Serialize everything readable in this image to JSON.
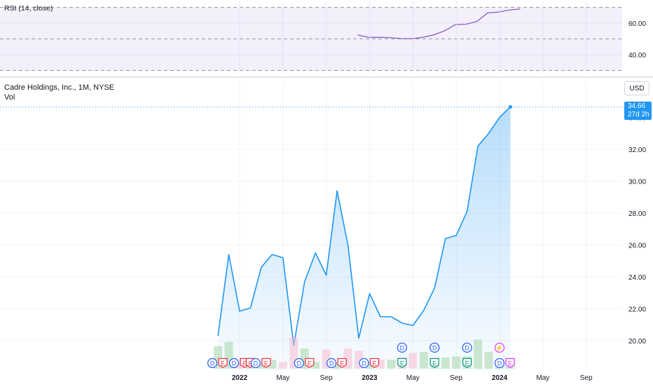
{
  "header": {
    "rsi_title": "RSI (14, close)",
    "symbol_title": "Cadre Holdings, Inc., 1M, NYSE",
    "vol_label": "Vol",
    "currency": "USD",
    "last_price": "34.66",
    "countdown": "27d 2h"
  },
  "colors": {
    "line": "#2196f3",
    "rsi_line": "#7e57c2",
    "rsi_band": "#f3effb",
    "vol_up": "#a5d6a7",
    "vol_down": "#f8bbd0",
    "dividend": "#2962ff",
    "earnings_red": "#f23645",
    "earnings_green": "#089981",
    "earnings_purple": "#e040fb"
  },
  "chart_data": [
    {
      "type": "line",
      "title": "Cadre Holdings, Inc., 1M, NYSE",
      "x_axis_labels": [
        "2022",
        "May",
        "Sep",
        "2023",
        "May",
        "Sep",
        "2024",
        "May",
        "Sep"
      ],
      "y_axis_labels": [
        "20.00",
        "22.00",
        "24.00",
        "26.00",
        "28.00",
        "30.00",
        "32.00"
      ],
      "ylim": [
        18.5,
        34.8
      ],
      "x": [
        "2021-11",
        "2021-12",
        "2022-01",
        "2022-02",
        "2022-03",
        "2022-04",
        "2022-05",
        "2022-06",
        "2022-07",
        "2022-08",
        "2022-09",
        "2022-10",
        "2022-11",
        "2022-12",
        "2023-01",
        "2023-02",
        "2023-03",
        "2023-04",
        "2023-05",
        "2023-06",
        "2023-07",
        "2023-08",
        "2023-09",
        "2023-10",
        "2023-11",
        "2023-12",
        "2024-01",
        "2024-02"
      ],
      "series": [
        {
          "values": [
            20.3,
            25.4,
            21.85,
            22.05,
            24.6,
            25.4,
            25.2,
            19.7,
            23.7,
            25.5,
            24.1,
            29.4,
            26.0,
            20.15,
            22.95,
            21.5,
            21.5,
            21.1,
            20.95,
            21.9,
            23.3,
            26.4,
            26.6,
            28.1,
            32.2,
            33.0,
            34.0,
            34.66
          ]
        }
      ],
      "last_value": "34.66",
      "grid": true
    },
    {
      "type": "bar",
      "name": "Vol",
      "x": [
        "2021-11",
        "2021-12",
        "2022-01",
        "2022-02",
        "2022-03",
        "2022-04",
        "2022-05",
        "2022-06",
        "2022-07",
        "2022-08",
        "2022-09",
        "2022-10",
        "2022-11",
        "2022-12",
        "2023-01",
        "2023-02",
        "2023-03",
        "2023-04",
        "2023-05",
        "2023-06",
        "2023-07",
        "2023-08",
        "2023-09",
        "2023-10",
        "2023-11",
        "2023-12",
        "2024-01",
        "2024-02"
      ],
      "values": [
        1.0,
        1.2,
        0.25,
        0.3,
        0.2,
        0.4,
        0.3,
        1.4,
        0.9,
        0.3,
        0.85,
        0.25,
        0.9,
        0.8,
        0.3,
        0.4,
        0.4,
        0.5,
        0.7,
        0.75,
        0.3,
        0.5,
        0.55,
        0.55,
        1.3,
        0.75,
        0.4,
        0.25
      ],
      "direction": [
        "up",
        "up",
        "down",
        "up",
        "up",
        "up",
        "down",
        "down",
        "up",
        "up",
        "down",
        "up",
        "down",
        "down",
        "up",
        "down",
        "up",
        "down",
        "down",
        "up",
        "up",
        "up",
        "up",
        "up",
        "up",
        "up",
        "up",
        "up"
      ]
    },
    {
      "type": "line",
      "title": "RSI (14, close)",
      "y_axis_labels": [
        "60.00",
        "40.00"
      ],
      "ylim": [
        30,
        70
      ],
      "x": [
        "2022-12",
        "2023-01",
        "2023-02",
        "2023-03",
        "2023-04",
        "2023-05",
        "2023-06",
        "2023-07",
        "2023-08",
        "2023-09",
        "2023-10",
        "2023-11",
        "2023-12",
        "2024-01",
        "2024-02"
      ],
      "series": [
        {
          "values": [
            52.5,
            51.0,
            51.0,
            50.8,
            50.2,
            50.1,
            51.0,
            52.5,
            55.0,
            59.0,
            59.3,
            61.0,
            66.5,
            67.0,
            68.3,
            69.0
          ]
        }
      ],
      "bands": [
        70,
        50,
        30
      ]
    }
  ],
  "events": [
    {
      "month": "2021-11",
      "labels": [
        "D",
        "E"
      ],
      "colors": [
        "dividend",
        "earnings_red"
      ]
    },
    {
      "month": "2022-01",
      "labels": [
        "D",
        "E"
      ],
      "colors": [
        "dividend",
        "earnings_red"
      ]
    },
    {
      "month": "2022-02",
      "labels": [
        "E"
      ],
      "colors": [
        "earnings_red"
      ]
    },
    {
      "month": "2022-03",
      "labels": [
        "D",
        "E"
      ],
      "colors": [
        "dividend",
        "earnings_red"
      ]
    },
    {
      "month": "2022-07",
      "labels": [
        "D",
        "E"
      ],
      "colors": [
        "dividend",
        "earnings_red"
      ]
    },
    {
      "month": "2022-10",
      "labels": [
        "D",
        "E"
      ],
      "colors": [
        "dividend",
        "earnings_red"
      ]
    },
    {
      "month": "2023-01",
      "labels": [
        "D",
        "E"
      ],
      "colors": [
        "dividend",
        "earnings_red"
      ]
    },
    {
      "month": "2023-04",
      "labels": [
        "D",
        "E"
      ],
      "colors": [
        "dividend",
        "earnings_green"
      ]
    },
    {
      "month": "2023-07",
      "labels": [
        "D",
        "E"
      ],
      "colors": [
        "dividend",
        "earnings_green"
      ]
    },
    {
      "month": "2023-10",
      "labels": [
        "D",
        "E"
      ],
      "colors": [
        "dividend",
        "earnings_green"
      ]
    },
    {
      "month": "2024-01",
      "labels": [
        "⚡",
        "D",
        "E"
      ],
      "colors": [
        "earnings_purple",
        "dividend",
        "earnings_purple"
      ]
    }
  ]
}
